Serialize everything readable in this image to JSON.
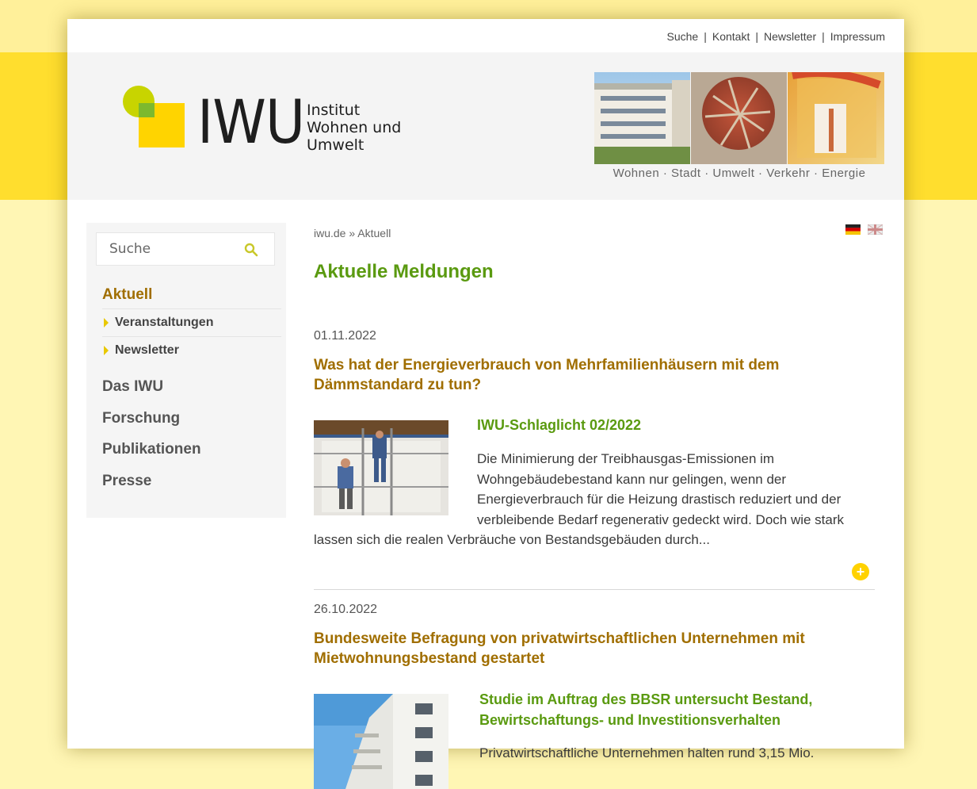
{
  "topnav": [
    "Suche",
    "Kontakt",
    "Newsletter",
    "Impressum"
  ],
  "logo": {
    "text": "IWU",
    "sub_line1": "Institut",
    "sub_line2": "Wohnen und",
    "sub_line3": "Umwelt"
  },
  "header": {
    "tagline": "Wohnen · Stadt · Umwelt · Verkehr · Energie"
  },
  "search": {
    "placeholder": "Suche"
  },
  "sidebar": {
    "active": "Aktuell",
    "subitems": [
      "Veranstaltungen",
      "Newsletter"
    ],
    "items": [
      "Das IWU",
      "Forschung",
      "Publikationen",
      "Presse"
    ]
  },
  "breadcrumb": {
    "home": "iwu.de",
    "sep": "»",
    "current": "Aktuell"
  },
  "main": {
    "title": "Aktuelle Meldungen"
  },
  "news": [
    {
      "date": "01.11.2022",
      "headline": "Was hat der Energieverbrauch von Mehrfamilienhäusern mit dem Dämmstandard zu tun?",
      "subhead": "IWU-Schlaglicht 02/2022",
      "teaser_line1": "Die Minimierung der Treibhausgas-Emissionen im",
      "teaser_line2": "Wohngebäudebestand kann nur gelingen, wenn der",
      "teaser_line3": "Energieverbrauch für die Heizung drastisch reduziert und der",
      "teaser_line4": "verbleibende Bedarf regenerativ gedeckt wird. Doch wie stark",
      "teaser_line5": "lassen sich die realen Verbräuche von Bestandsgebäuden durch...",
      "more": "+"
    },
    {
      "date": "26.10.2022",
      "headline": "Bundesweite Befragung von privatwirtschaftlichen Unternehmen mit Mietwohnungsbestand gestartet",
      "subhead_line1": "Studie im Auftrag des BBSR untersucht Bestand,",
      "subhead_line2": "Bewirtschaftungs- und Investitionsverhalten",
      "teaser_line1": "Privatwirtschaftliche Unternehmen halten rund 3,15 Mio."
    }
  ],
  "colors": {
    "accent_green": "#5a9a10",
    "accent_brown": "#a06e00",
    "yellow": "#ffde2e"
  }
}
